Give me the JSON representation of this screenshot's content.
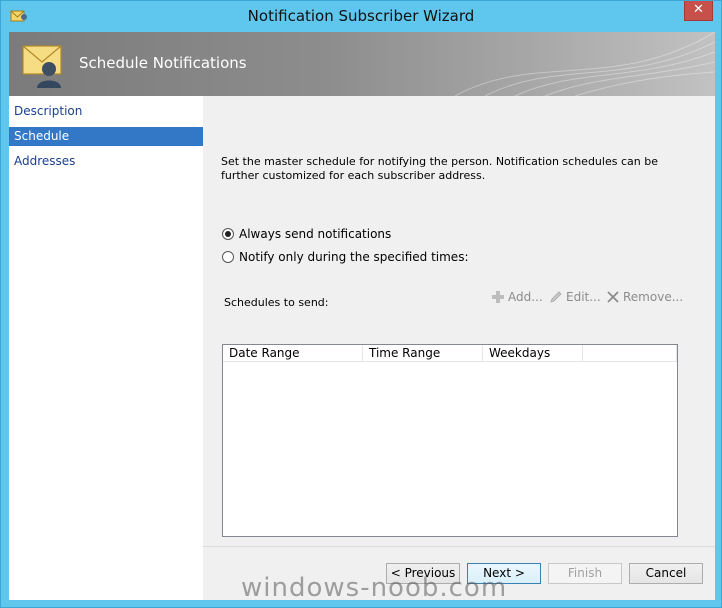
{
  "window": {
    "title": "Notification Subscriber Wizard",
    "close_glyph": "✕"
  },
  "banner": {
    "title": "Schedule Notifications"
  },
  "nav": {
    "items": [
      {
        "label": "Description",
        "selected": false
      },
      {
        "label": "Schedule",
        "selected": true
      },
      {
        "label": "Addresses",
        "selected": false
      }
    ]
  },
  "content": {
    "description": "Set the master schedule for notifying the person. Notification schedules can be further customized for each subscriber address.",
    "radio_always": "Always send notifications",
    "radio_specified": "Notify only during the specified times:",
    "selected_option": "always",
    "schedules_label": "Schedules to send:",
    "toolbar": {
      "add": "Add...",
      "edit": "Edit...",
      "remove": "Remove..."
    },
    "columns": [
      "Date Range",
      "Time Range",
      "Weekdays"
    ]
  },
  "buttons": {
    "previous": "< Previous",
    "next": "Next >",
    "finish": "Finish",
    "cancel": "Cancel"
  },
  "watermark": "windows-noob.com",
  "colors": {
    "titlebar": "#5fc6ee",
    "nav_selected": "#3378c6",
    "close_button": "#c7504b"
  }
}
